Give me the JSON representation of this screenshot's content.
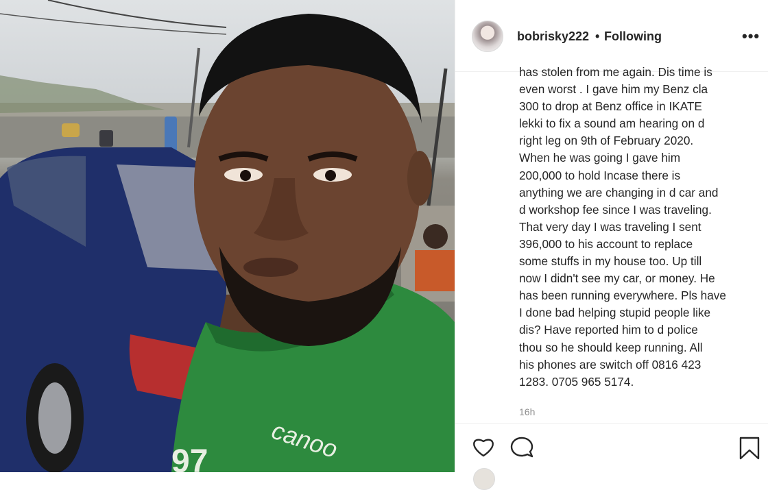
{
  "post": {
    "username": "bobrisky222",
    "separator": "•",
    "follow_status": "Following",
    "more_label": "•••",
    "caption": "has stolen from me again. Dis time is\neven worst . I gave him my Benz cla\n300 to drop at Benz office in IKATE\nlekki to fix a sound am hearing on d\nright leg on 9th of February 2020.\nWhen he was going I gave him\n200,000 to hold Incase there is\nanything we are changing in d car and\nd workshop fee since I was traveling.\nThat very day I was traveling I sent\n396,000 to his account to replace\nsome stuffs in my house too. Up till\nnow I didn't see my car, or money. He\nhas been running everywhere. Pls have\nI done bad helping stupid people like\ndis? Have reported him to d police\nthou so he should keep running. All\nhis phones are switch off 0816 423\n1283. 0705 965 5174.",
    "timestamp": "16h"
  },
  "actions": {
    "like_icon": "heart-icon",
    "comment_icon": "comment-icon",
    "save_icon": "bookmark-icon"
  },
  "photo": {
    "jersey_text": "canoo",
    "jersey_number": "97"
  },
  "colors": {
    "text": "#262626",
    "muted": "#8e8e8e",
    "divider": "#efefef",
    "jersey_green": "#2d8a3e"
  }
}
